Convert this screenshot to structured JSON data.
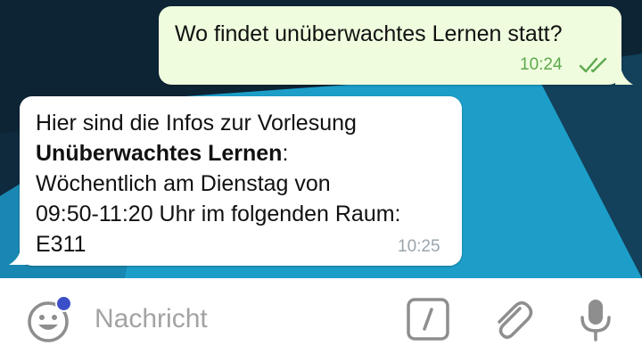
{
  "messages": {
    "outgoing": {
      "text": "Wo findet unüberwachtes Lernen statt?",
      "time": "10:24"
    },
    "incoming": {
      "line1": "Hier sind die Infos zur Vorlesung",
      "title": "Unüberwachtes Lernen",
      "title_suffix": ":",
      "line3": "Wöchentlich am Dienstag von",
      "line4": "09:50-11:20 Uhr im folgenden Raum:",
      "line5": "E311",
      "time": "10:25"
    }
  },
  "input_bar": {
    "placeholder": "Nachricht",
    "icons": [
      "emoji-icon",
      "bot-command-icon",
      "paperclip-icon",
      "microphone-icon"
    ]
  },
  "colors": {
    "outgoing_bubble": "#effdde",
    "incoming_bubble": "#ffffff",
    "read_check": "#5ea94e",
    "notification_dot": "#3b50c8",
    "background_accent": "#1c9ec9",
    "background_dark": "#0f2a3d"
  }
}
